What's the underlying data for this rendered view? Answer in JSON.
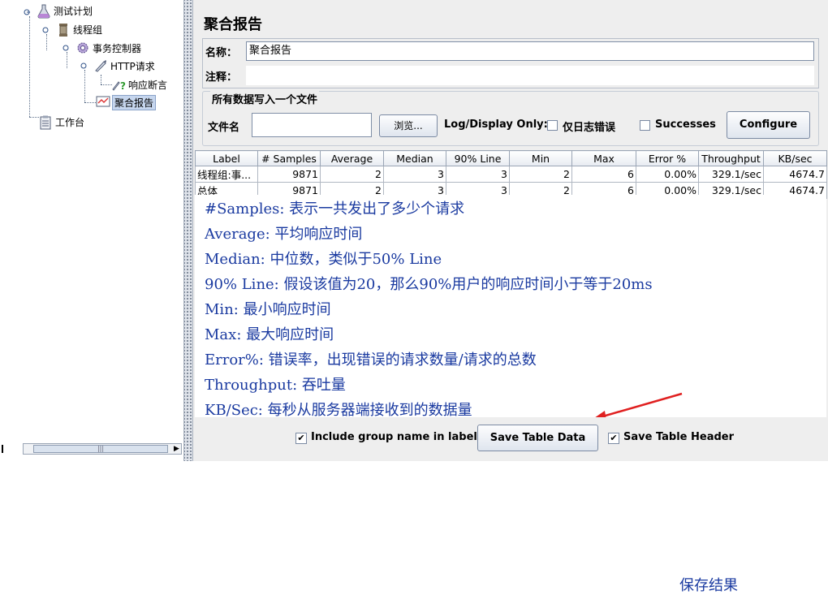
{
  "tree": {
    "test_plan": "测试计划",
    "thread_group": "线程组",
    "transaction_controller": "事务控制器",
    "http_request": "HTTP请求",
    "response_assertion": "响应断言",
    "aggregate_report": "聚合报告",
    "workbench": "工作台"
  },
  "report": {
    "title": "聚合报告",
    "name_label": "名称：",
    "name_value": "聚合报告",
    "comment_label": "注释：",
    "comment_value": ""
  },
  "file_section": {
    "title": "所有数据写入一个文件",
    "filename_label": "文件名",
    "filename_value": "",
    "browse_button": "浏览...",
    "log_display_label": "Log/Display Only:",
    "errors_only_label": "仅日志错误",
    "successes_label": "Successes",
    "configure_button": "Configure"
  },
  "table": {
    "headers": [
      "Label",
      "# Samples",
      "Average",
      "Median",
      "90% Line",
      "Min",
      "Max",
      "Error %",
      "Throughput",
      "KB/sec"
    ],
    "rows": [
      [
        "线程组:事...",
        "9871",
        "2",
        "3",
        "3",
        "2",
        "6",
        "0.00%",
        "329.1/sec",
        "4674.7"
      ],
      [
        "总体",
        "9871",
        "2",
        "3",
        "3",
        "2",
        "6",
        "0.00%",
        "329.1/sec",
        "4674.7"
      ]
    ]
  },
  "notes": [
    "#Samples: 表示一共发出了多少个请求",
    "Average: 平均响应时间",
    "Median: 中位数，类似于50% Line",
    "90% Line: 假设该值为20，那么90%用户的响应时间小于等于20ms",
    "Min: 最小响应时间",
    "Max: 最大响应时间",
    "Error%: 错误率，出现错误的请求数量/请求的总数",
    "Throughput: 吞吐量",
    "KB/Sec: 每秒从服务器端接收到的数据量"
  ],
  "annotation": {
    "text": "保存结果",
    "arrow_color": "#e02020"
  },
  "bottom_bar": {
    "include_group_label": "Include group name in label?",
    "include_group_checked": true,
    "save_table_data": "Save Table Data",
    "save_table_header_label": "Save Table Header",
    "save_table_header_checked": true
  },
  "colors": {
    "note_text": "#1a3aa0",
    "panel_bg": "#eeeeee",
    "selection_bg": "#c6d6ee"
  }
}
